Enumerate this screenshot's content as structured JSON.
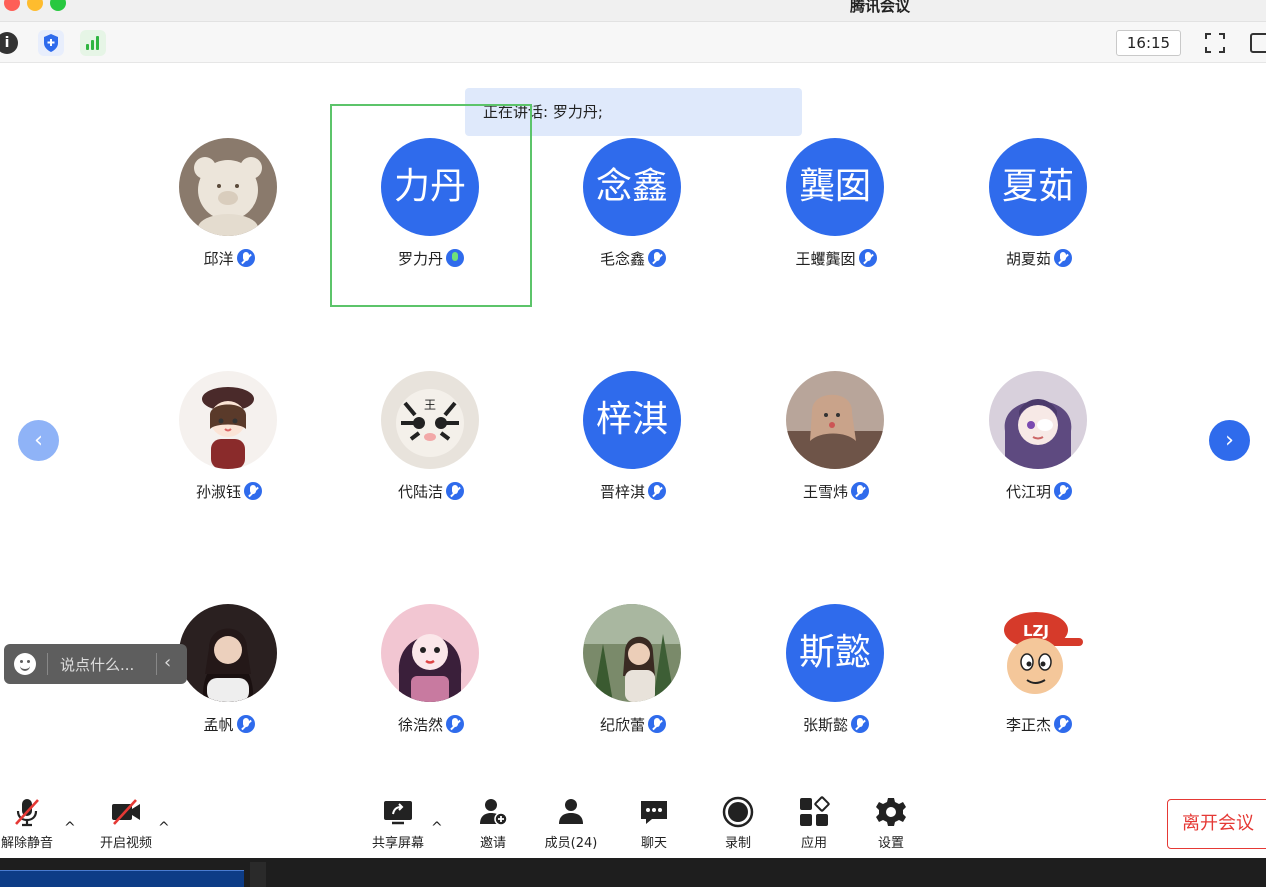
{
  "window": {
    "title": "腾讯会议"
  },
  "topbar": {
    "time": "16:15"
  },
  "speaking_banner": "正在讲话: 罗力丹;",
  "participants": [
    {
      "name": "邱洋",
      "avatar_text": "",
      "avatar_kind": "photo-bear"
    },
    {
      "name": "罗力丹",
      "avatar_text": "力丹",
      "avatar_kind": "text",
      "speaking": true
    },
    {
      "name": "毛念鑫",
      "avatar_text": "念鑫",
      "avatar_kind": "text"
    },
    {
      "name": "王蠼龔囡",
      "avatar_text": "龔囡",
      "avatar_kind": "text"
    },
    {
      "name": "胡夏茹",
      "avatar_text": "夏茹",
      "avatar_kind": "text"
    },
    {
      "name": "孙淑钰",
      "avatar_text": "",
      "avatar_kind": "photo-girl-beret"
    },
    {
      "name": "代陆洁",
      "avatar_text": "",
      "avatar_kind": "photo-tiger"
    },
    {
      "name": "晋梓淇",
      "avatar_text": "梓淇",
      "avatar_kind": "text"
    },
    {
      "name": "王雪炜",
      "avatar_text": "",
      "avatar_kind": "photo-child"
    },
    {
      "name": "代江玥",
      "avatar_text": "",
      "avatar_kind": "photo-anime-purple"
    },
    {
      "name": "孟帆",
      "avatar_text": "",
      "avatar_kind": "photo-woman-dark"
    },
    {
      "name": "徐浩然",
      "avatar_text": "",
      "avatar_kind": "photo-anime-pink"
    },
    {
      "name": "纪欣蕾",
      "avatar_text": "",
      "avatar_kind": "photo-woman-plants"
    },
    {
      "name": "张斯懿",
      "avatar_text": "斯懿",
      "avatar_kind": "text"
    },
    {
      "name": "李正杰",
      "avatar_text": "",
      "avatar_kind": "photo-cartoon-lzj",
      "cap_text": "LZJ"
    }
  ],
  "chat": {
    "placeholder": "说点什么..."
  },
  "toolbar": {
    "unmute": "解除静音",
    "start_video": "开启视频",
    "share_screen": "共享屏幕",
    "invite": "邀请",
    "members": "成员(24)",
    "chat": "聊天",
    "record": "录制",
    "apps": "应用",
    "settings": "设置",
    "leave": "离开会议"
  },
  "colors": {
    "accent": "#2f6bec",
    "speaking_frame": "#5cc46a",
    "leave": "#e53935"
  }
}
